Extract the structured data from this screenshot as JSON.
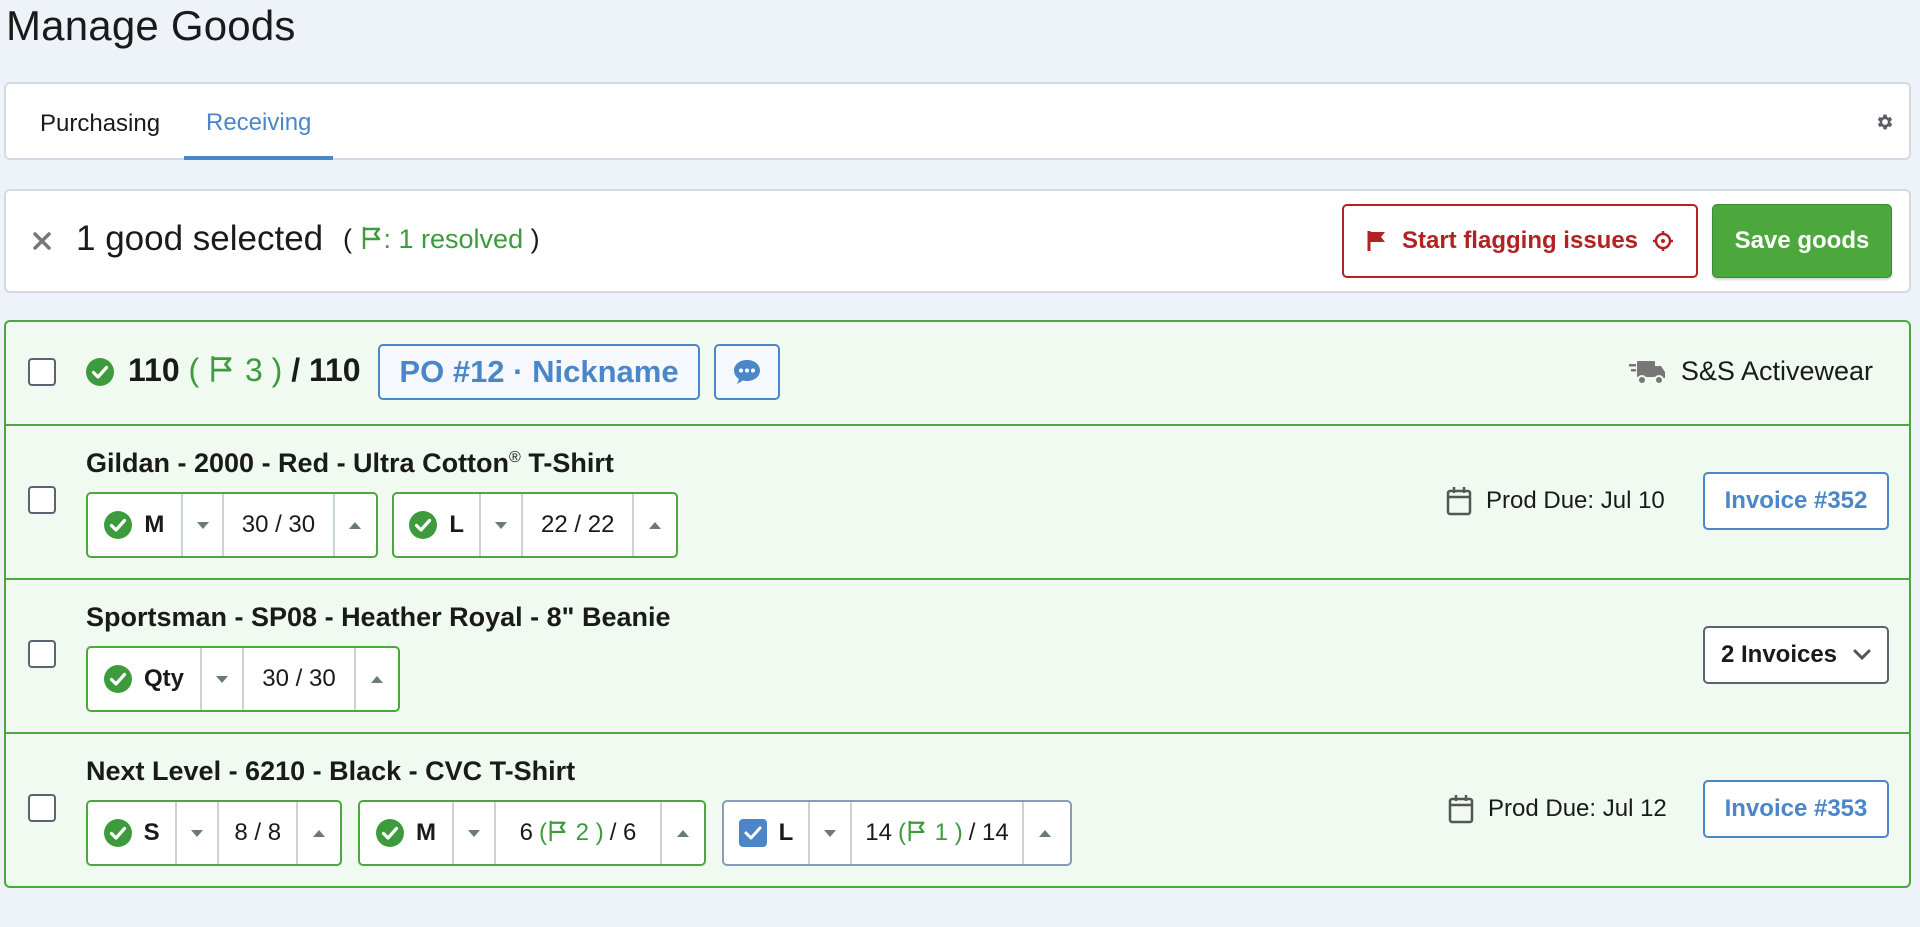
{
  "page": {
    "title": "Manage Goods"
  },
  "tabs": [
    {
      "label": "Purchasing",
      "active": false
    },
    {
      "label": "Receiving",
      "active": true
    }
  ],
  "selection": {
    "text": "1 good selected",
    "note_open": "(",
    "resolved": ": 1 resolved",
    "note_close": ")",
    "flag_button": "Start flagging issues",
    "save_button": "Save goods"
  },
  "po": {
    "received": "110",
    "flag_open": "(",
    "flag_count": "3",
    "flag_close": ")",
    "slash": "/",
    "total": "110",
    "badge": "PO #12 · Nickname",
    "vendor": "S&S Activewear"
  },
  "items": [
    {
      "title": "Gildan - 2000 - Red - Ultra Cotton",
      "title_sup": "®",
      "title_suffix": " T-Shirt",
      "sizes": [
        {
          "label": "M",
          "value": "30 / 30"
        },
        {
          "label": "L",
          "value": "22 / 22"
        }
      ],
      "due": "Prod Due: Jul 10",
      "invoice": "Invoice #352"
    },
    {
      "title": "Sportsman - SP08 - Heather Royal - 8\" Beanie",
      "sizes": [
        {
          "label": "Qty",
          "value": "30 / 30"
        }
      ],
      "invoices_dropdown": "2 Invoices"
    },
    {
      "title": "Next Level - 6210 - Black - CVC T-Shirt",
      "sizes": [
        {
          "label": "S",
          "value": "8 / 8"
        },
        {
          "label": "M",
          "value_pre": "6",
          "flag_open": "(",
          "flag_count": "2",
          "flag_close": ")",
          "value_post": "/ 6"
        },
        {
          "label": "L",
          "value_pre": "14",
          "flag_open": "(",
          "flag_count": "1",
          "flag_close": ")",
          "value_post": "/ 14"
        }
      ],
      "due": "Prod Due: Jul 12",
      "invoice": "Invoice #353"
    }
  ],
  "colors": {
    "accent_blue": "#4a86c8",
    "success_green": "#4ca73d",
    "danger_red": "#b22222",
    "card_green_bg": "#f0faf0",
    "page_bg": "#eef2f9"
  },
  "icons": [
    "gear-icon",
    "close-icon",
    "flag-icon",
    "crosshair-icon",
    "check-circle-icon",
    "chat-icon",
    "truck-icon",
    "calendar-icon",
    "chevron-down-icon",
    "caret-down-icon",
    "caret-up-icon",
    "checkbox-checked-icon"
  ]
}
